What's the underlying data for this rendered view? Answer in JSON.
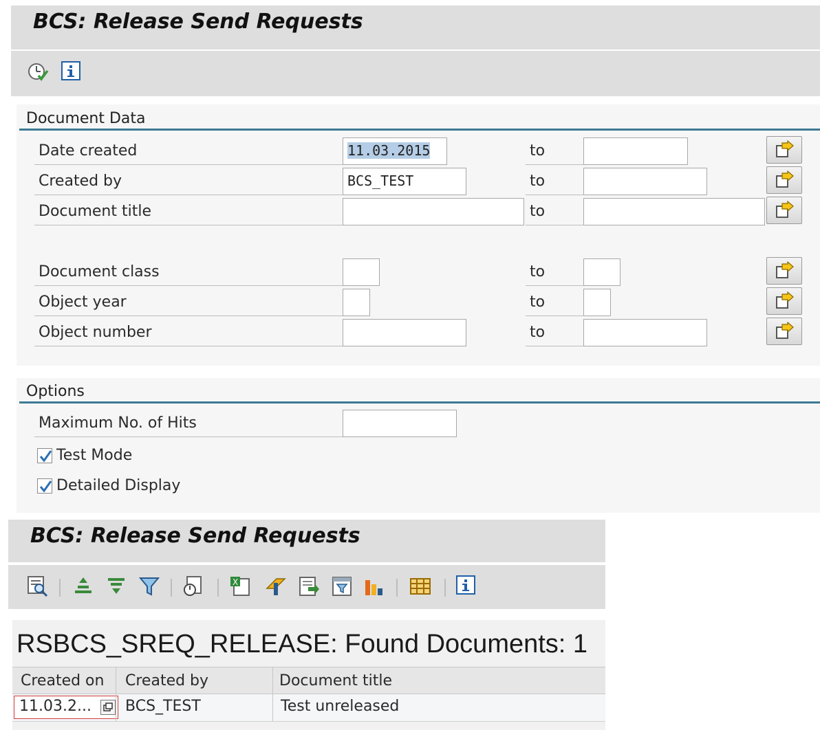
{
  "selection_screen": {
    "title": "BCS: Release Send Requests",
    "toolbar": {
      "execute_icon": "execute-icon",
      "info_icon": "info-icon"
    },
    "document_data": {
      "group_title": "Document Data",
      "to_label": "to",
      "rows": [
        {
          "label": "Date created",
          "from": "11.03.2015",
          "to": ""
        },
        {
          "label": "Created by",
          "from": "BCS_TEST",
          "to": ""
        },
        {
          "label": "Document title",
          "from": "",
          "to": ""
        },
        {
          "label": "Document class",
          "from": "",
          "to": ""
        },
        {
          "label": "Object year",
          "from": "",
          "to": ""
        },
        {
          "label": "Object number",
          "from": "",
          "to": ""
        }
      ]
    },
    "options": {
      "group_title": "Options",
      "max_hits_label": "Maximum No. of Hits",
      "max_hits_value": "",
      "test_mode_label": "Test Mode",
      "test_mode_checked": true,
      "detailed_display_label": "Detailed Display",
      "detailed_display_checked": true
    }
  },
  "result_screen": {
    "title": "BCS: Release Send Requests",
    "toolbar_icons": [
      "details-icon",
      "sort-ascending-icon",
      "sort-descending-icon",
      "filter-icon",
      "sum-icon",
      "spreadsheet-icon",
      "export-icon",
      "word-processing-icon",
      "local-file-icon",
      "abc-analysis-icon",
      "layout-icon",
      "info-icon"
    ],
    "list_header": "RSBCS_SREQ_RELEASE: Found Documents: 1",
    "columns": [
      "Created on",
      "Created by",
      "Document title"
    ],
    "rows": [
      {
        "created_on": "11.03.2...",
        "created_by": "BCS_TEST",
        "document_title": "Test unreleased"
      }
    ]
  },
  "colors": {
    "group_line": "#3b7a93",
    "title_bar": "#dedede",
    "selection": "#b5cde6"
  }
}
